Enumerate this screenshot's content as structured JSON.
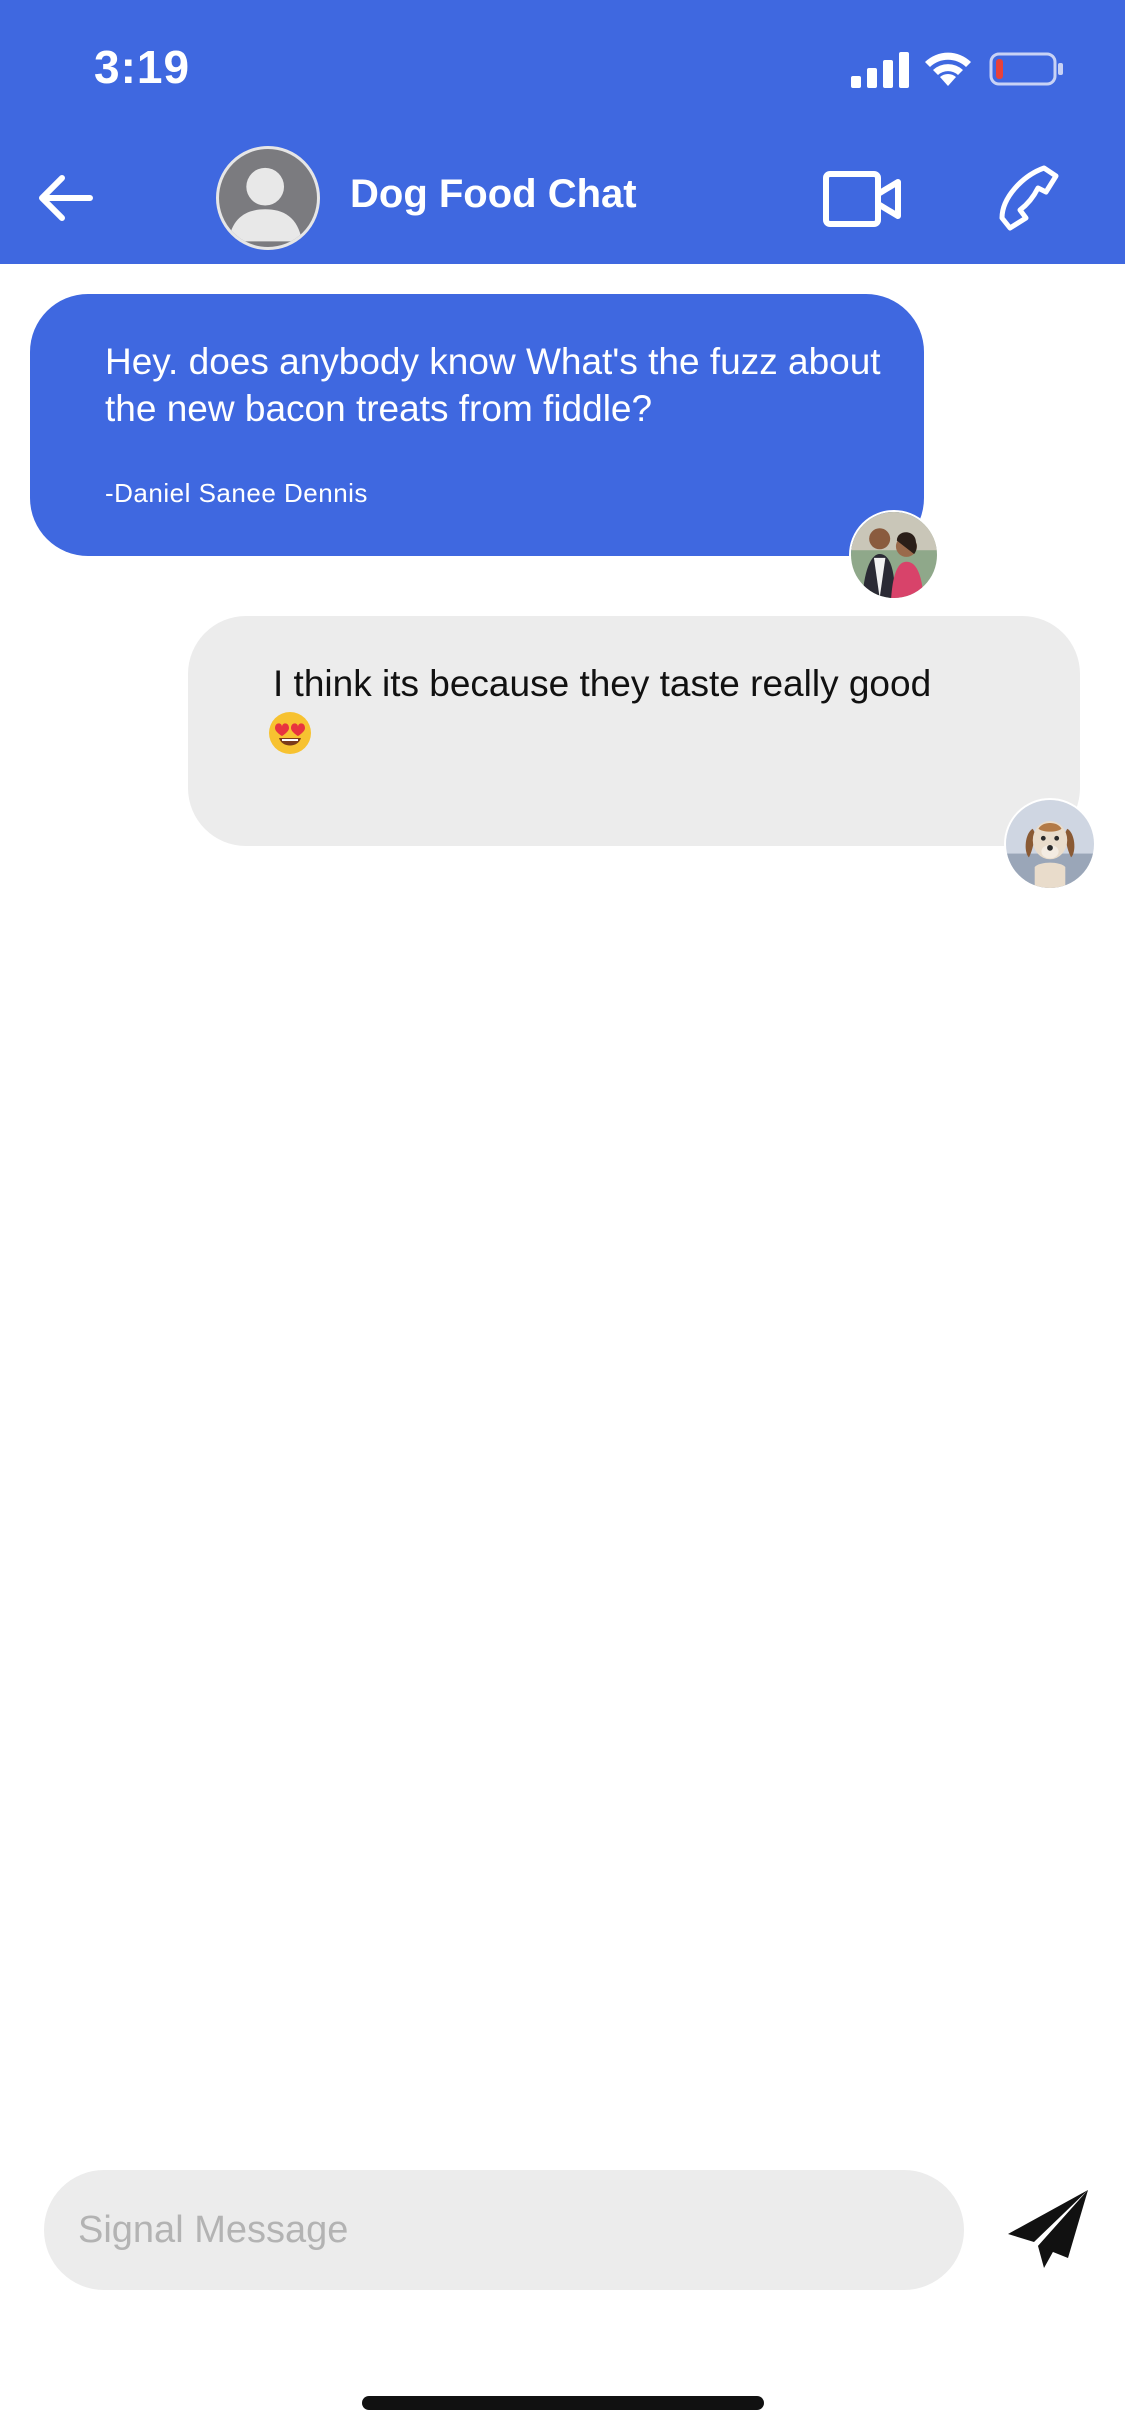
{
  "status_bar": {
    "time": "3:19",
    "icons": [
      "cellular-signal-icon",
      "wifi-icon",
      "battery-low-icon"
    ]
  },
  "header": {
    "title": "Dog Food Chat",
    "back_icon": "arrow-left-icon",
    "avatar_icon": "person-silhouette-icon",
    "video_icon": "video-camera-icon",
    "call_icon": "phone-icon"
  },
  "messages": [
    {
      "direction": "incoming",
      "text": "Hey. does anybody know What's the fuzz about the new bacon treats from fiddle?",
      "author": "-Daniel Sanee Dennis",
      "avatar": "couple-photo-avatar"
    },
    {
      "direction": "outgoing",
      "text": "I think its because they taste really good",
      "emoji": "heart-eyes-emoji",
      "avatar": "dog-photo-avatar"
    }
  ],
  "composer": {
    "placeholder": "Signal Message",
    "value": "",
    "send_icon": "send-paper-plane-icon"
  },
  "colors": {
    "accent": "#3f68e0",
    "incoming_bubble": "#3f68e0",
    "outgoing_bubble": "#ececec",
    "composer_bg": "#ececec",
    "battery_low": "#e8413a"
  }
}
